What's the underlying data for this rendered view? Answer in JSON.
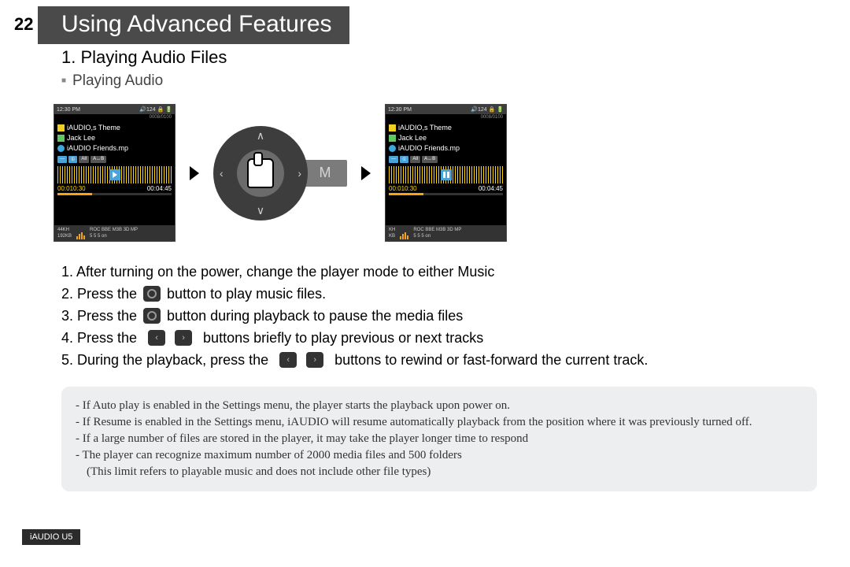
{
  "page_number": "22",
  "title": "Using Advanced Features",
  "section_heading": "1. Playing Audio Files",
  "subsection_heading": "Playing Audio",
  "device": {
    "status_time": "12:30 PM",
    "status_vol": "124",
    "status_icons": "🔒 🔋",
    "counter": "0008/0100",
    "line_theme": "iAUDIO,s Theme",
    "line_artist": "Jack Lee",
    "line_track": "iAUDIO Friends.mp",
    "badges": [
      "—",
      "①",
      "All",
      "A↔B"
    ],
    "time_elapsed": "00:010:30",
    "time_total": "00:04:45",
    "bottom_l1": "44KH",
    "bottom_l2": "192KB",
    "bottom_cols": "ROC  BBE  M3B  3D  MP",
    "bottom_vals": "5    5    5   on",
    "second_bottom_l1": "KH",
    "second_bottom_l2": "KB",
    "m_label": "M"
  },
  "instructions": {
    "i1": "1. After turning on the power, change the player mode to either Music",
    "i2a": "2. Press the",
    "i2b": "button to play music files.",
    "i3a": "3. Press the",
    "i3b": "button during playback to pause the media files",
    "i4a": "4. Press the",
    "i4b": "buttons briefly to play previous or next tracks",
    "i5a": "5. During the playback, press the",
    "i5b": "buttons to rewind or fast-forward the current track."
  },
  "notes": {
    "n1": "- If Auto play is enabled in the Settings menu, the player starts the playback upon power on.",
    "n2": "- If Resume is enabled in the Settings menu, iAUDIO will resume automatically playback from the position where it was previously turned off.",
    "n3": "- If a large number of files are stored in the player, it may take the player longer time to respond",
    "n4": "- The player can recognize maximum number of 2000 media files and 500 folders",
    "n4sub": "(This limit refers to playable music and does not include other file types)"
  },
  "footer": "iAUDIO U5"
}
